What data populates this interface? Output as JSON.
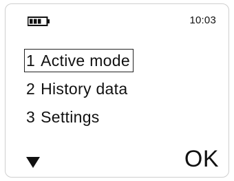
{
  "status_bar": {
    "battery_icon": "battery-icon",
    "battery_level": 0.75,
    "time": "10:03"
  },
  "menu": {
    "items": [
      {
        "number": "1",
        "label": "Active mode",
        "selected": true
      },
      {
        "number": "2",
        "label": "History data",
        "selected": false
      },
      {
        "number": "3",
        "label": "Settings",
        "selected": false
      }
    ]
  },
  "softkeys": {
    "left_icon": "down-arrow-icon",
    "right_label": "OK"
  }
}
